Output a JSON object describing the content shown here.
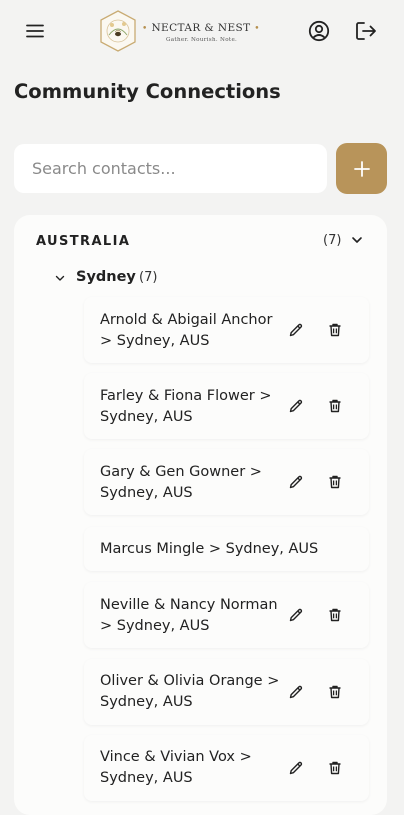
{
  "header": {
    "brand_name": "NECTAR & NEST",
    "brand_dot": "•",
    "tagline": "Gather. Nourish. Note.",
    "icons": [
      "menu-icon",
      "account-icon",
      "logout-icon"
    ]
  },
  "page": {
    "title": "Community Connections"
  },
  "search": {
    "placeholder": "Search contacts..."
  },
  "add_button": {
    "label": "+"
  },
  "colors": {
    "accent": "#b8945a",
    "background": "#f3f3f2",
    "panel": "#fcfcfb"
  },
  "groups": [
    {
      "country": "AUSTRALIA",
      "count": "(7)",
      "expanded": true,
      "cities": [
        {
          "name": "Sydney",
          "count": "(7)",
          "expanded": true,
          "contacts": [
            {
              "name": "Arnold & Abigail Anchor > Sydney, AUS",
              "actions": true
            },
            {
              "name": "Farley & Fiona Flower > Sydney, AUS",
              "actions": true
            },
            {
              "name": "Gary & Gen Gowner > Sydney, AUS",
              "actions": true
            },
            {
              "name": "Marcus Mingle > Sydney, AUS",
              "actions": false
            },
            {
              "name": "Neville & Nancy Norman > Sydney, AUS",
              "actions": true
            },
            {
              "name": "Oliver & Olivia Orange > Sydney, AUS",
              "actions": true
            },
            {
              "name": "Vince & Vivian Vox > Sydney, AUS",
              "actions": true
            }
          ]
        }
      ]
    }
  ]
}
